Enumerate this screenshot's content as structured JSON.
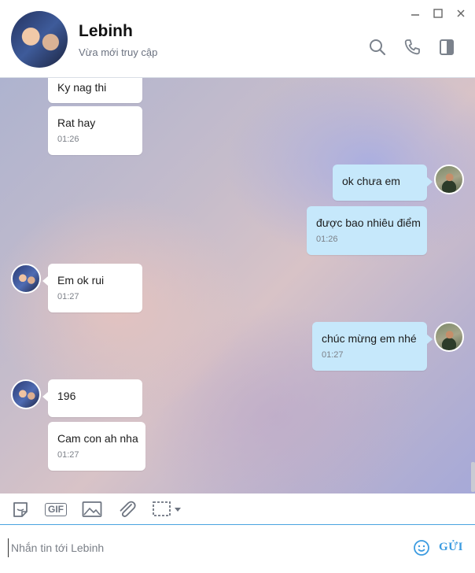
{
  "contact": {
    "name": "Lebinh",
    "status": "Vừa mới truy cập"
  },
  "window_controls": {
    "minimize": "minimize-icon",
    "maximize": "maximize-icon",
    "close": "close-icon"
  },
  "header_actions": [
    "search-icon",
    "phone-icon",
    "sidebar-toggle-icon"
  ],
  "messages": [
    {
      "id": 0,
      "from": "contact",
      "text": "Ky nag thi",
      "time": ""
    },
    {
      "id": 1,
      "from": "contact",
      "text": "Rat hay",
      "time": "01:26"
    },
    {
      "id": 2,
      "from": "me",
      "text": "ok chưa em",
      "time": ""
    },
    {
      "id": 3,
      "from": "me",
      "text": "được bao nhiêu điểm",
      "time": "01:26"
    },
    {
      "id": 4,
      "from": "contact",
      "text": "Em ok rui",
      "time": "01:27"
    },
    {
      "id": 5,
      "from": "me",
      "text": "chúc mừng em nhé",
      "time": "01:27"
    },
    {
      "id": 6,
      "from": "contact",
      "text": "196",
      "time": ""
    },
    {
      "id": 7,
      "from": "contact",
      "text": "Cam con ah nha",
      "time": "01:27"
    }
  ],
  "toolbar": {
    "sticker": "sticker-icon",
    "gif": "GIF",
    "image": "image-icon",
    "attach": "paperclip-icon",
    "screenshot": "screenshot-icon"
  },
  "composer": {
    "placeholder": "Nhắn tin tới Lebinh",
    "value": "",
    "send_label": "GỬI"
  },
  "colors": {
    "accent": "#3b9be0",
    "outgoing_bubble": "#c6e8fb",
    "incoming_bubble": "#ffffff"
  }
}
